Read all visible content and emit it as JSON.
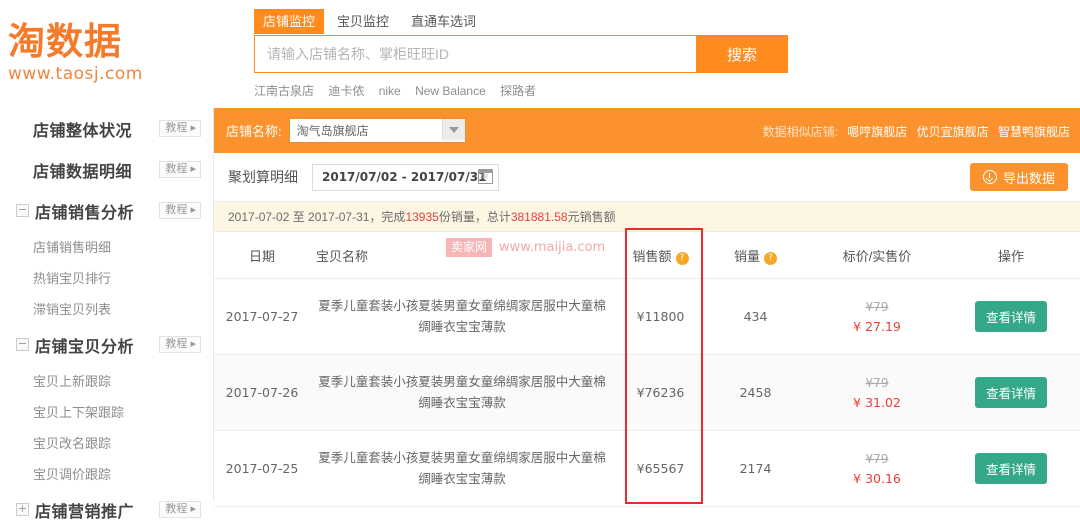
{
  "brand": {
    "logo_cn": "淘数据",
    "logo_url": "www.taosj.com"
  },
  "search": {
    "tabs": [
      {
        "label": "店铺监控",
        "active": true
      },
      {
        "label": "宝贝监控",
        "active": false
      },
      {
        "label": "直通车选词",
        "active": false
      }
    ],
    "placeholder": "请输入店铺名称、掌柜旺旺ID",
    "value": "",
    "button_label": "搜索",
    "hot_links": [
      "江南古泉店",
      "迪卡侬",
      "nike",
      "New Balance",
      "探路者"
    ]
  },
  "sidebar": {
    "groups": [
      {
        "toggle": "",
        "label": "店铺整体状况",
        "badge": "教程 ▸",
        "children": []
      },
      {
        "toggle": "",
        "label": "店铺数据明细",
        "badge": "教程 ▸",
        "children": []
      },
      {
        "toggle": "−",
        "label": "店铺销售分析",
        "badge": "教程 ▸",
        "children": [
          "店铺销售明细",
          "热销宝贝排行",
          "滞销宝贝列表"
        ]
      },
      {
        "toggle": "−",
        "label": "店铺宝贝分析",
        "badge": "教程 ▸",
        "children": [
          "宝贝上新跟踪",
          "宝贝上下架跟踪",
          "宝贝改名跟踪",
          "宝贝调价跟踪"
        ]
      },
      {
        "toggle": "+",
        "label": "店铺营销推广",
        "badge": "教程 ▸",
        "children": []
      }
    ]
  },
  "shopbar": {
    "shop_label": "店铺名称:",
    "shop_selected": "淘气岛旗舰店",
    "similar_label": "数据相似店铺:",
    "similar_shops": [
      "嗯哼旗舰店",
      "优贝宜旗舰店",
      "智慧鸭旗舰店"
    ],
    "accent_color": "#fb922e"
  },
  "toolbar": {
    "section_label": "聚划算明细",
    "date_range": "2017/07/02 - 2017/07/31",
    "calendar_icon": "calendar-icon",
    "export_label": "导出数据",
    "export_icon": "download-icon"
  },
  "summary": {
    "prefix": "2017-07-02 至 2017-07-31，完成",
    "orders": "13935",
    "middle": "份销量，总计",
    "amount": "381881.58",
    "suffix": "元销售额",
    "highlight_color": "#e8403a"
  },
  "watermark": {
    "badge": "卖家网",
    "url": "www.maijia.com"
  },
  "annotation": {
    "highlighted_column": "销售额",
    "box_color": "#ef2929"
  },
  "table": {
    "columns": [
      {
        "label": "日期",
        "help": false
      },
      {
        "label": "宝贝名称",
        "help": false
      },
      {
        "label": "销售额",
        "help": true
      },
      {
        "label": "销量",
        "help": true
      },
      {
        "label": "标价/实售价",
        "help": false
      },
      {
        "label": "操作",
        "help": false
      }
    ],
    "help_glyph": "?",
    "action_label": "查看详情",
    "rows": [
      {
        "date": "2017-07-27",
        "product": "夏季儿童套装小孩夏装男童女童绵绸家居服中大童棉绸睡衣宝宝薄款",
        "amount": "¥11800",
        "qty": "434",
        "list_price": "¥79",
        "sale_price": "¥ 27.19",
        "action": "查看详情"
      },
      {
        "date": "2017-07-26",
        "product": "夏季儿童套装小孩夏装男童女童绵绸家居服中大童棉绸睡衣宝宝薄款",
        "amount": "¥76236",
        "qty": "2458",
        "list_price": "¥79",
        "sale_price": "¥ 31.02",
        "action": "查看详情"
      },
      {
        "date": "2017-07-25",
        "product": "夏季儿童套装小孩夏装男童女童绵绸家居服中大童棉绸睡衣宝宝薄款",
        "amount": "¥65567",
        "qty": "2174",
        "list_price": "¥79",
        "sale_price": "¥ 30.16",
        "action": "查看详情"
      }
    ]
  }
}
